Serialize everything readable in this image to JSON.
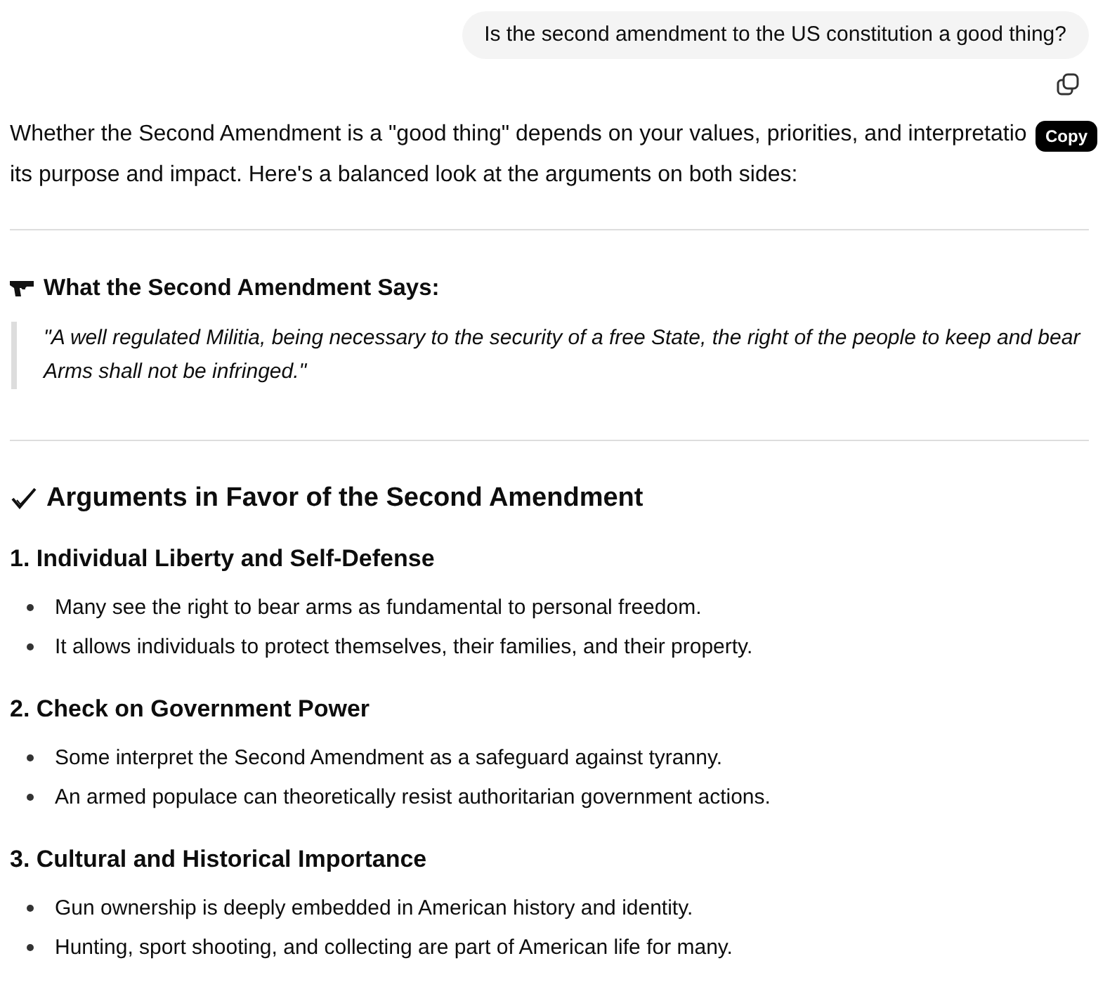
{
  "user_message": "Is the second amendment to the US constitution a good thing?",
  "copy_tooltip": "Copy",
  "intro_lines": [
    "Whether the Second Amendment is a \"good thing\" depends on your values, priorities, and interpretatio",
    "its purpose and impact. Here's a balanced look at the arguments on both sides:"
  ],
  "text_section": {
    "heading": "What the Second Amendment Says:",
    "quote": "\"A well regulated Militia, being necessary to the security of a free State, the right of the people to keep and bear Arms shall not be infringed.\""
  },
  "favor_section": {
    "heading": "Arguments in Favor of the Second Amendment",
    "points": [
      {
        "title": "1. Individual Liberty and Self-Defense",
        "bullets": [
          "Many see the right to bear arms as fundamental to personal freedom.",
          "It allows individuals to protect themselves, their families, and their property."
        ]
      },
      {
        "title": "2. Check on Government Power",
        "bullets": [
          "Some interpret the Second Amendment as a safeguard against tyranny.",
          "An armed populace can theoretically resist authoritarian government actions."
        ]
      },
      {
        "title": "3. Cultural and Historical Importance",
        "bullets": [
          "Gun ownership is deeply embedded in American history and identity.",
          "Hunting, sport shooting, and collecting are part of American life for many."
        ]
      }
    ]
  }
}
